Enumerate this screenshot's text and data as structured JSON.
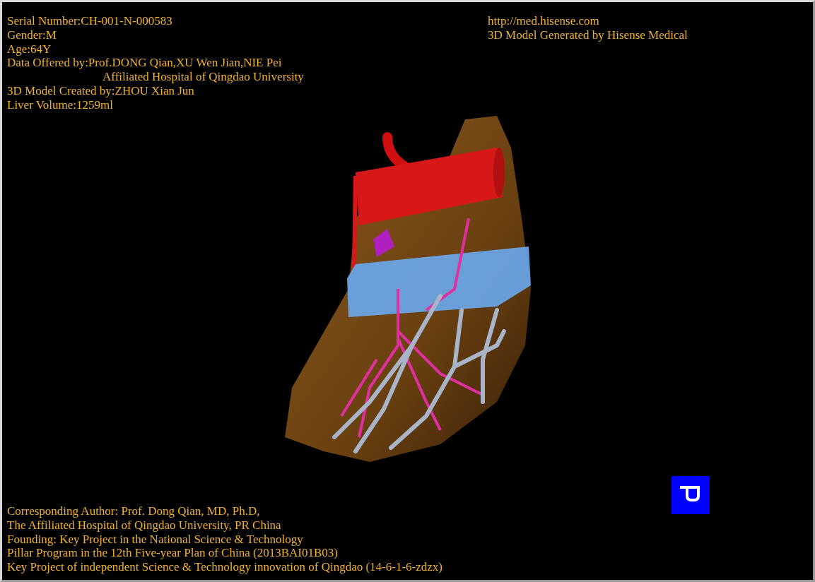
{
  "patient_info": [
    {
      "kind": "line",
      "text": "Serial Number:CH-001-N-000583"
    },
    {
      "kind": "line",
      "text": "Gender:M"
    },
    {
      "kind": "line",
      "text": "Age:64Y"
    },
    {
      "kind": "line",
      "text": "Data Offered by:Prof.DONG Qian,XU Wen Jian,NIE Pei"
    },
    {
      "kind": "continuation",
      "text": "Affiliated Hospital of Qingdao University"
    },
    {
      "kind": "line",
      "text": "3D Model Created by:ZHOU Xian Jun"
    },
    {
      "kind": "line",
      "text": "Liver Volume:1259ml"
    }
  ],
  "source_info": [
    "http://med.hisense.com",
    "3D Model Generated by Hisense Medical"
  ],
  "credits": [
    "Corresponding Author: Prof. Dong Qian, MD, Ph.D,",
    "The Affiliated Hospital of Qingdao University, PR China",
    "Founding: Key Project in the National Science & Technology",
    "Pillar Program in the 12th Five-year Plan of China (2013BAI01B03)",
    "Key Project of independent Science & Technology innovation of Qingdao (14-6-1-6-zdzx)"
  ]
}
